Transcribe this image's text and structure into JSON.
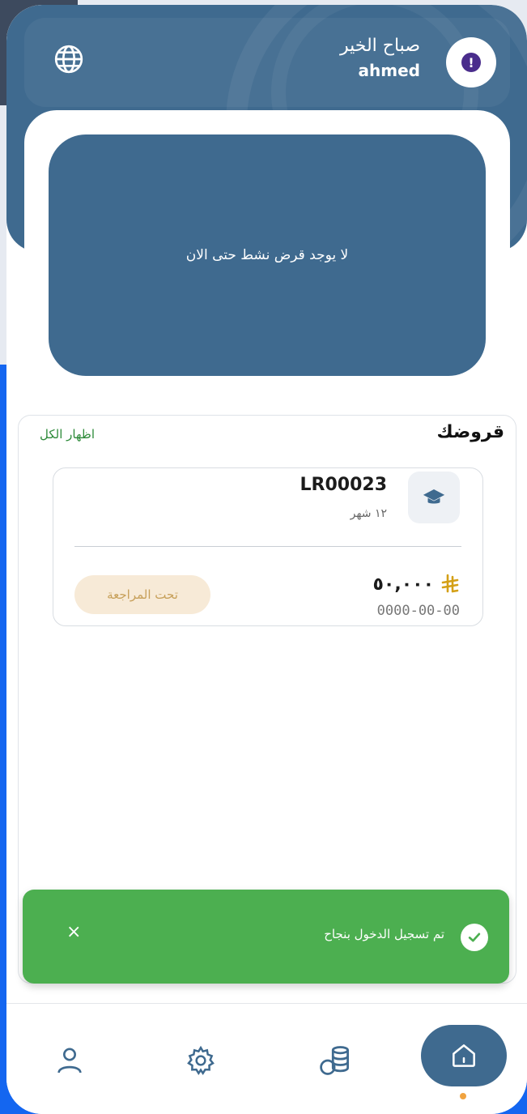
{
  "header": {
    "greeting": "صباح الخير",
    "username": "ahmed"
  },
  "active_loan": {
    "empty_message": "لا يوجد قرض نشط حتى الان"
  },
  "loans": {
    "title": "قروضك",
    "show_all": "اظهار الكل",
    "items": [
      {
        "id": "LR00023",
        "term": "١٢ شهر",
        "amount": "٥٠,٠٠٠",
        "date": "0000-00-00",
        "status": "تحت المراجعة"
      }
    ]
  },
  "toast": {
    "message": "تم تسجيل الدخول بنجاح",
    "close": "×"
  },
  "nav": {
    "items": [
      "profile-icon",
      "settings-icon",
      "coins-icon",
      "home-icon"
    ],
    "active": "home-icon"
  },
  "colors": {
    "primary": "#3f6a8f",
    "success": "#4caf50",
    "accent": "#f0a340",
    "badge_bg": "#f7ead7",
    "badge_text": "#c7a05a",
    "link": "#2e8b3a"
  }
}
